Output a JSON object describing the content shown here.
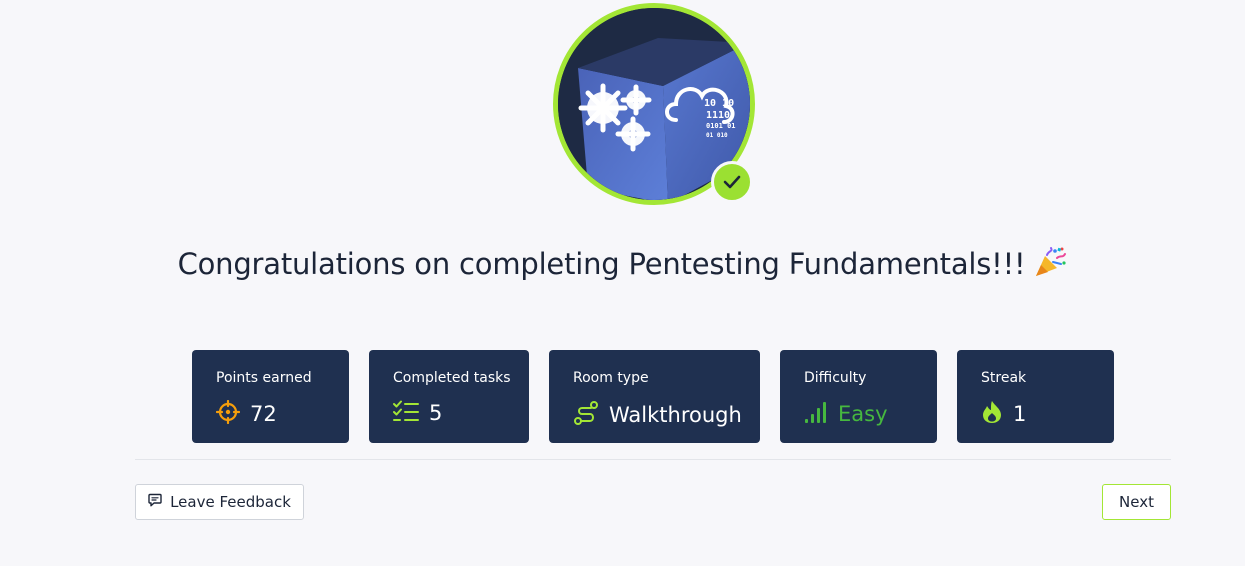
{
  "page": {
    "title": "Congratulations on completing Pentesting Fundamentals!!!",
    "title_emoji": "party-popper-icon"
  },
  "badge": {
    "icon": "cloud-gears-cube-badge",
    "binary_text": [
      "10 10",
      "1110",
      "0101 01",
      "01 010"
    ],
    "status": "completed",
    "accent_color": "#a3e635"
  },
  "stats": [
    {
      "label": "Points earned",
      "value": "72",
      "icon": "crosshair-icon",
      "icon_color": "#f59e0b"
    },
    {
      "label": "Completed tasks",
      "value": "5",
      "icon": "checklist-icon",
      "icon_color": "#a3e635"
    },
    {
      "label": "Room type",
      "value": "Walkthrough",
      "icon": "route-icon",
      "icon_color": "#a3e635"
    },
    {
      "label": "Difficulty",
      "value": "Easy",
      "icon": "signal-bars-icon",
      "icon_color": "#46b83f"
    },
    {
      "label": "Streak",
      "value": "1",
      "icon": "flame-icon",
      "icon_color": "#a3e635"
    }
  ],
  "actions": {
    "feedback_label": "Leave Feedback",
    "next_label": "Next"
  },
  "colors": {
    "card_background": "#1f3050",
    "page_background": "#f7f7fa",
    "accent": "#a3e635"
  }
}
